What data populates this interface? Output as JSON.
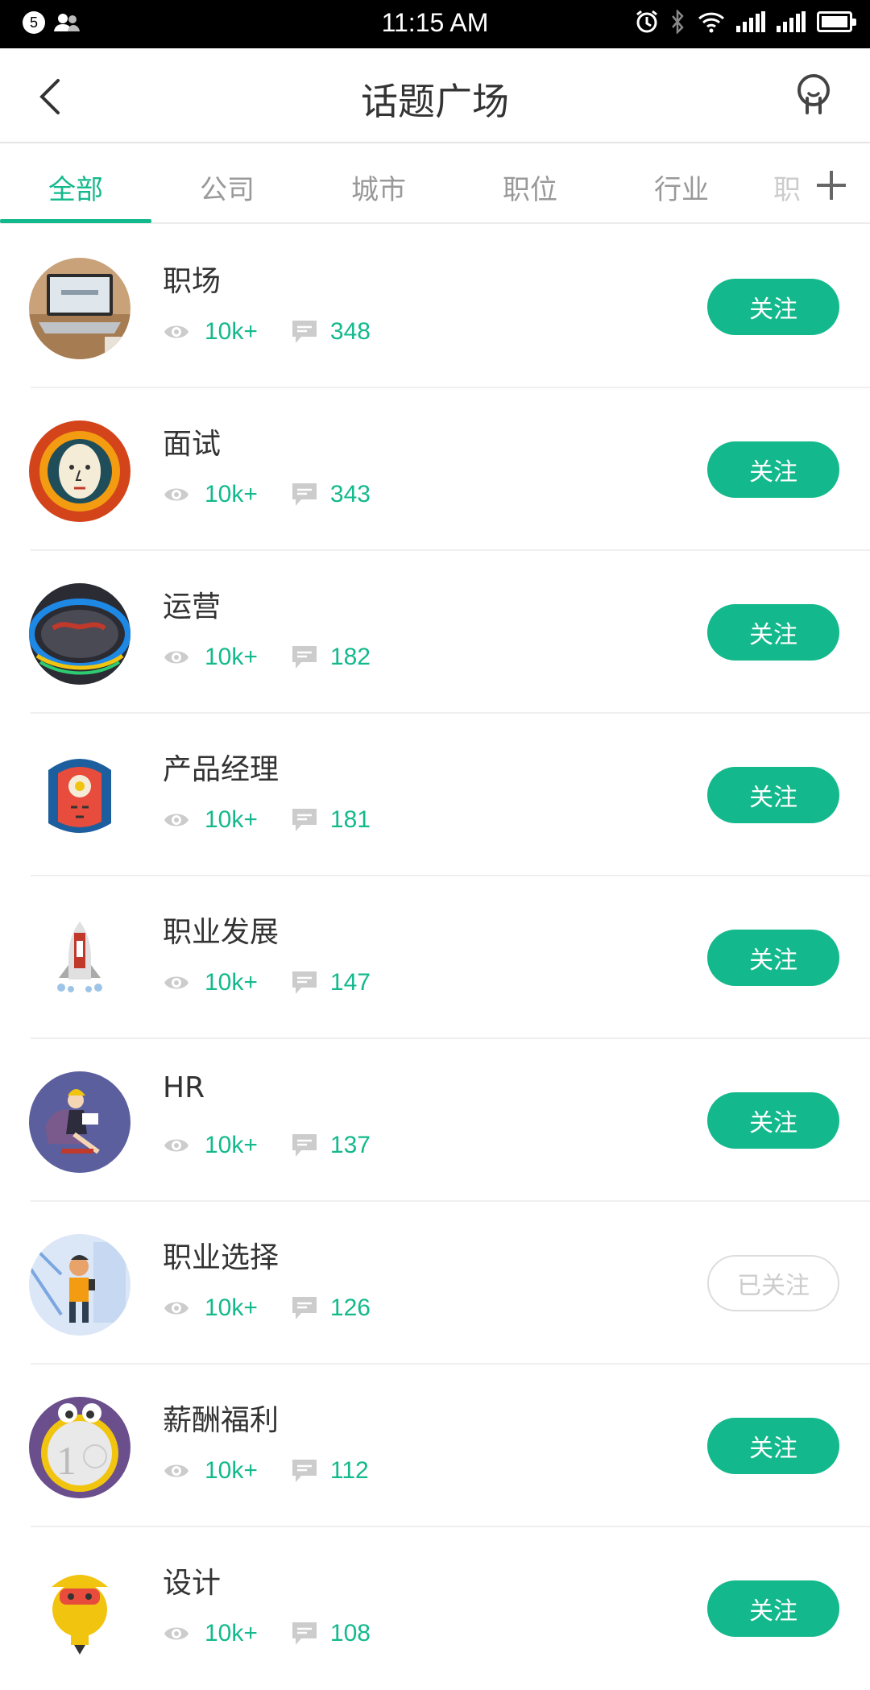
{
  "status_bar": {
    "time": "11:15 AM",
    "notification_count": "5"
  },
  "header": {
    "title": "话题广场"
  },
  "tabs": [
    {
      "label": "全部",
      "active": true
    },
    {
      "label": "公司"
    },
    {
      "label": "城市"
    },
    {
      "label": "职位"
    },
    {
      "label": "行业"
    },
    {
      "label": "职"
    }
  ],
  "topics": [
    {
      "name": "职场",
      "views": "10k+",
      "comments": "348",
      "follow_label": "关注",
      "followed": false,
      "icon": "laptop-desk-avatar"
    },
    {
      "name": "面试",
      "views": "10k+",
      "comments": "343",
      "follow_label": "关注",
      "followed": false,
      "icon": "face-gear-avatar"
    },
    {
      "name": "运营",
      "views": "10k+",
      "comments": "182",
      "follow_label": "关注",
      "followed": false,
      "icon": "world-map-ring-avatar"
    },
    {
      "name": "产品经理",
      "views": "10k+",
      "comments": "181",
      "follow_label": "关注",
      "followed": false,
      "icon": "thinking-head-avatar"
    },
    {
      "name": "职业发展",
      "views": "10k+",
      "comments": "147",
      "follow_label": "关注",
      "followed": false,
      "icon": "rocket-avatar"
    },
    {
      "name": "HR",
      "views": "10k+",
      "comments": "137",
      "follow_label": "关注",
      "followed": false,
      "icon": "reading-woman-avatar"
    },
    {
      "name": "职业选择",
      "views": "10k+",
      "comments": "126",
      "follow_label": "已关注",
      "followed": true,
      "icon": "man-phone-avatar"
    },
    {
      "name": "薪酬福利",
      "views": "10k+",
      "comments": "112",
      "follow_label": "关注",
      "followed": false,
      "icon": "euro-coin-avatar"
    },
    {
      "name": "设计",
      "views": "10k+",
      "comments": "108",
      "follow_label": "关注",
      "followed": false,
      "icon": "lightbulb-avatar"
    }
  ],
  "colors": {
    "accent": "#13b98c",
    "status_bar": "#000000",
    "muted_text": "#999999"
  }
}
